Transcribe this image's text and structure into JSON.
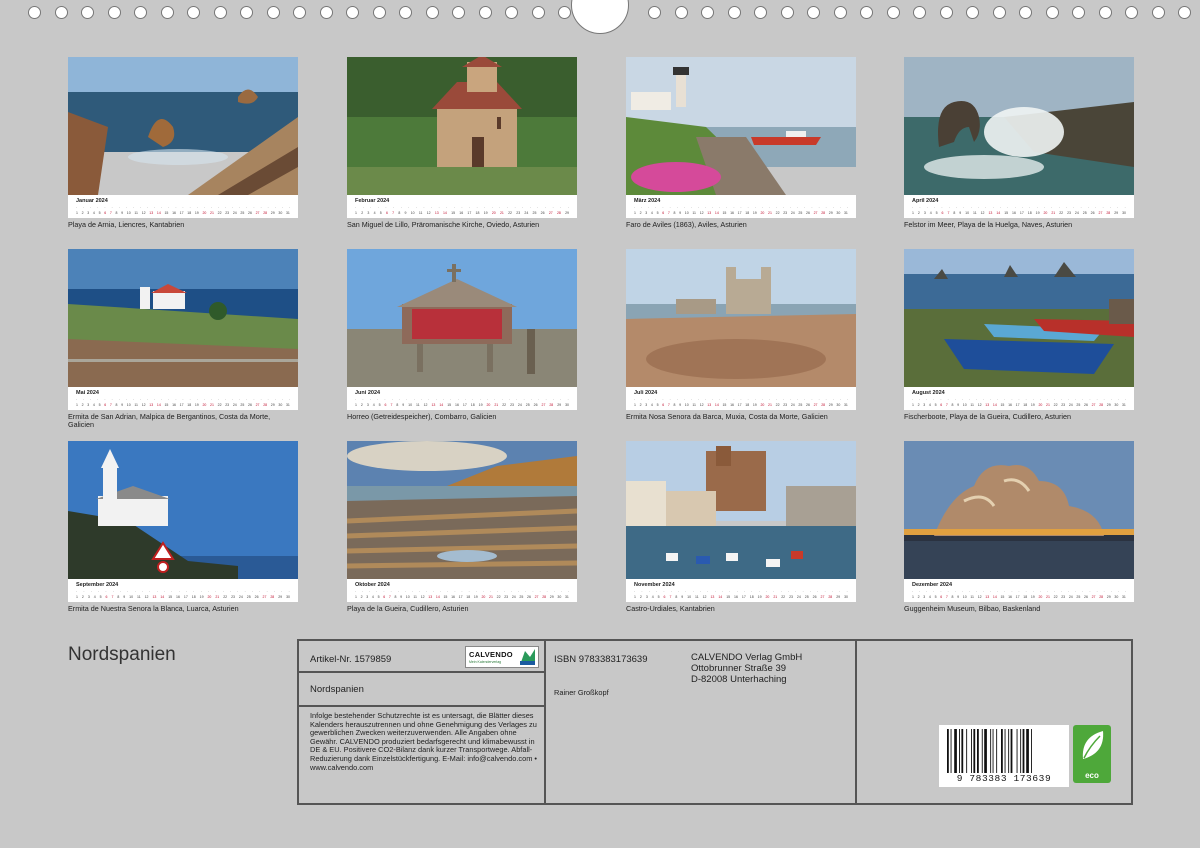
{
  "title": "Nordspanien",
  "months": [
    {
      "name": "Januar 2024",
      "caption": "Playa de Arnia, Liencres, Kantabrien"
    },
    {
      "name": "Februar 2024",
      "caption": "San Miguel de Lillo, Präromanische Kirche, Oviedo, Asturien"
    },
    {
      "name": "März 2024",
      "caption": "Faro de Aviles (1863), Aviles, Asturien"
    },
    {
      "name": "April 2024",
      "caption": "Felstor im Meer, Playa de la Huelga, Naves, Asturien"
    },
    {
      "name": "Mai 2024",
      "caption": "Ermita de San Adrian, Malpica de Bergantinos, Costa da Morte, Galicien"
    },
    {
      "name": "Juni 2024",
      "caption": "Horreo (Getreidespeicher), Combarro, Galicien"
    },
    {
      "name": "Juli 2024",
      "caption": "Ermita Nosa Senora da Barca, Muxia, Costa da Morte, Galicien"
    },
    {
      "name": "August 2024",
      "caption": "Fischerboote, Playa de la Gueira, Cudillero, Asturien"
    },
    {
      "name": "September 2024",
      "caption": "Ermita de Nuestra Senora la Blanca, Luarca, Asturien"
    },
    {
      "name": "Oktober 2024",
      "caption": "Playa de la Gueira, Cudillero, Asturien"
    },
    {
      "name": "November 2024",
      "caption": "Castro-Urdiales, Kantabrien"
    },
    {
      "name": "Dezember 2024",
      "caption": "Guggenheim Museum, Bilbao, Baskenland"
    }
  ],
  "info": {
    "article": "Artikel-Nr. 1579859",
    "logo_text": "CALVENDO",
    "logo_sub": "Mein Kalenderverlag",
    "calendar_title": "Nordspanien",
    "notice": "Infolge bestehender Schutzrechte ist es untersagt, die Blätter dieses Kalenders herauszutrennen und ohne Genehmigung des Verlages zu gewerblichen Zwecken weiterzuverwenden. Alle Angaben ohne Gewähr. CALVENDO produziert bedarfsgerecht und klimabewusst in DE & EU. Positivere CO2-Bilanz dank kurzer Transportwege. Abfall-Reduzierung dank Einzelstückfertigung. E-Mail: info@calvendo.com • www.calvendo.com",
    "isbn": "ISBN 9783383173639",
    "author": "Rainer Großkopf",
    "publisher_line1": "CALVENDO Verlag GmbH",
    "publisher_line2": "Ottobrunner Straße 39",
    "publisher_line3": "D-82008 Unterhaching",
    "barcode_number": "9 783383 173639",
    "eco_label": "eco"
  },
  "colors": {
    "background": "#c8c8c8",
    "weekend": "#c01030",
    "eco_green": "#4ea83a"
  }
}
